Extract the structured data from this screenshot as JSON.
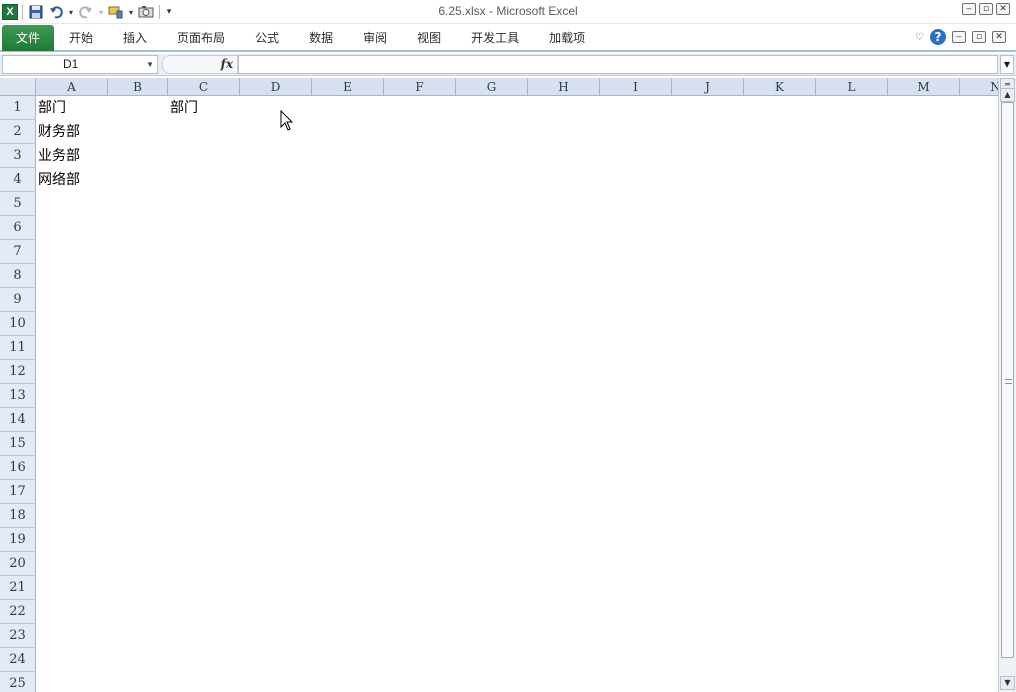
{
  "window": {
    "title": "6.25.xlsx  -  Microsoft Excel",
    "app_icon": "X",
    "qat_icons": [
      "excel-app-icon",
      "save-icon",
      "undo-icon",
      "redo-icon",
      "format-painter-icon",
      "camera-icon",
      "customize-qat-icon"
    ],
    "window_buttons": [
      "minimize",
      "restore",
      "close"
    ]
  },
  "ribbon": {
    "tabs": [
      "文件",
      "开始",
      "插入",
      "页面布局",
      "公式",
      "数据",
      "审阅",
      "视图",
      "开发工具",
      "加载项"
    ],
    "active_tab": "文件",
    "accent_color": "#2e8b47"
  },
  "formula_bar": {
    "name_box": "D1",
    "fx_label": "fx",
    "formula": ""
  },
  "sheet": {
    "columns": [
      "A",
      "B",
      "C",
      "D",
      "E",
      "F",
      "G",
      "H",
      "I",
      "J",
      "K",
      "L",
      "M",
      "N"
    ],
    "rows": [
      "1",
      "2",
      "3",
      "4",
      "5",
      "6",
      "7",
      "8",
      "9",
      "10",
      "11",
      "12",
      "13",
      "14",
      "15",
      "16",
      "17",
      "18",
      "19",
      "20",
      "21",
      "22",
      "23",
      "24",
      "25"
    ],
    "cells": {
      "A1": "部门",
      "C1": "部门",
      "A2": "财务部",
      "A3": "业务部",
      "A4": "网络部"
    },
    "selected_cell": "D1",
    "header_color": "#d7dff0"
  }
}
